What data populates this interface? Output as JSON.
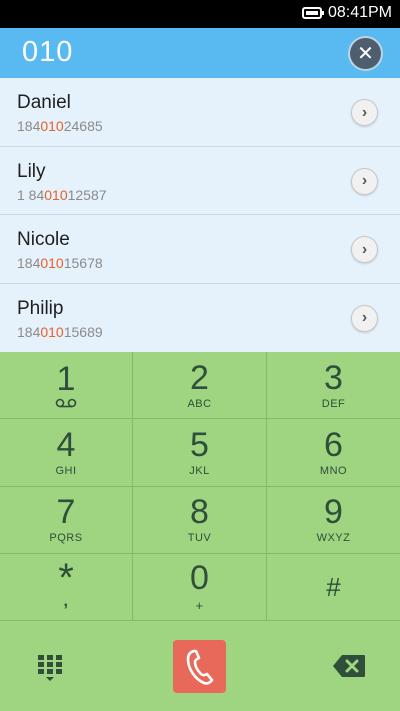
{
  "status_bar": {
    "time": "08:41PM"
  },
  "search": {
    "query": "010"
  },
  "results": [
    {
      "name": "Daniel",
      "number_pre": "184",
      "number_match": "010",
      "number_post": "24685"
    },
    {
      "name": "Lily",
      "number_pre": "1 84",
      "number_match": "010",
      "number_post": "12587"
    },
    {
      "name": "Nicole",
      "number_pre": "184",
      "number_match": "010",
      "number_post": "15678"
    },
    {
      "name": "Philip",
      "number_pre": "184",
      "number_match": "010",
      "number_post": "15689"
    }
  ],
  "keypad": {
    "k1": {
      "digit": "1"
    },
    "k2": {
      "digit": "2",
      "letters": "ABC"
    },
    "k3": {
      "digit": "3",
      "letters": "DEF"
    },
    "k4": {
      "digit": "4",
      "letters": "GHI"
    },
    "k5": {
      "digit": "5",
      "letters": "JKL"
    },
    "k6": {
      "digit": "6",
      "letters": "MNO"
    },
    "k7": {
      "digit": "7",
      "letters": "PQRS"
    },
    "k8": {
      "digit": "8",
      "letters": "TUV"
    },
    "k9": {
      "digit": "9",
      "letters": "WXYZ"
    },
    "kstar": {
      "digit": "*",
      "letters": ","
    },
    "k0": {
      "digit": "0",
      "letters": "+"
    },
    "khash": {
      "digit": "#"
    }
  },
  "icons": {
    "battery": "battery-icon",
    "clear": "clear-icon",
    "detail": "chevron-right-icon",
    "voicemail": "voicemail-icon",
    "dialpad": "dialpad-icon",
    "call": "phone-icon",
    "backspace": "backspace-icon"
  },
  "colors": {
    "search_bar": "#58baf0",
    "results_bg": "#e5f1fb",
    "highlight": "#e8612b",
    "keypad_bg": "#9fd481",
    "call_button": "#e8695a"
  }
}
